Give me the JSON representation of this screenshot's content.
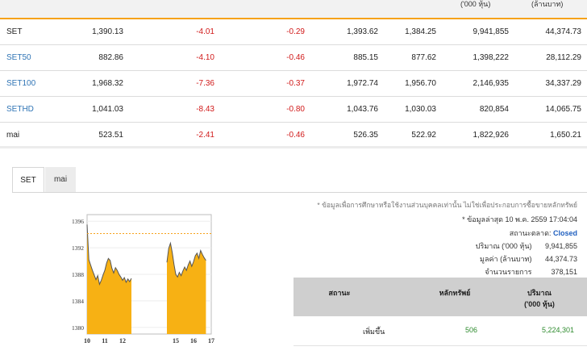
{
  "header": {
    "vol_unit": "('000 หุ้น)",
    "val_unit": "(ล้านบาท)"
  },
  "indices": [
    {
      "name": "SET",
      "last": "1,390.13",
      "change": "-4.01",
      "pct": "-0.29",
      "high": "1,393.62",
      "low": "1,384.25",
      "volume": "9,941,855",
      "value": "44,374.73"
    },
    {
      "name": "SET50",
      "last": "882.86",
      "change": "-4.10",
      "pct": "-0.46",
      "high": "885.15",
      "low": "877.62",
      "volume": "1,398,222",
      "value": "28,112.29"
    },
    {
      "name": "SET100",
      "last": "1,968.32",
      "change": "-7.36",
      "pct": "-0.37",
      "high": "1,972.74",
      "low": "1,956.70",
      "volume": "2,146,935",
      "value": "34,337.29"
    },
    {
      "name": "SETHD",
      "last": "1,041.03",
      "change": "-8.43",
      "pct": "-0.80",
      "high": "1,043.76",
      "low": "1,030.03",
      "volume": "820,854",
      "value": "14,065.75"
    },
    {
      "name": "mai",
      "last": "523.51",
      "change": "-2.41",
      "pct": "-0.46",
      "high": "526.35",
      "low": "522.92",
      "volume": "1,822,926",
      "value": "1,650.21"
    }
  ],
  "tabs": [
    "SET",
    "mai"
  ],
  "info": {
    "disclaimer": "* ข้อมูลเพื่อการศึกษาหรือใช้งานส่วนบุคคลเท่านั้น ไม่ใช่เพื่อประกอบการซื้อขายหลักทรัพย์",
    "updated": "* ข้อมูลล่าสุด 10 พ.ค. 2559 17:04:04",
    "market_status_label": "สถานะตลาด:",
    "market_status": "Closed",
    "volume_label": "ปริมาณ ('000 หุ้น)",
    "volume": "9,941,855",
    "value_label": "มูลค่า (ล้านบาท)",
    "value": "44,374.73",
    "trades_label": "จำนวนรายการ",
    "trades": "378,151"
  },
  "stat_table": {
    "col_status": "สถานะ",
    "col_securities": "หลักทรัพย์",
    "col_volume": "ปริมาณ\n('000 หุ้น)",
    "rows": [
      {
        "status": "เพิ่มขึ้น",
        "securities": "506",
        "volume": "5,224,301"
      }
    ]
  },
  "colors": {
    "accent": "#f6a21a",
    "negative": "#d11a1a",
    "positive": "#2e8b2e",
    "link": "#2f74b5"
  },
  "chart_data": {
    "type": "area",
    "title": "",
    "x_ticks": [
      "10",
      "11",
      "12",
      "15",
      "16",
      "17"
    ],
    "y_ticks": [
      1380,
      1384,
      1388,
      1392,
      1396
    ],
    "ylim": [
      1379,
      1397
    ],
    "reference_line": 1394.14,
    "sessions": [
      {
        "x": [
          10.0,
          10.1,
          10.2,
          10.3,
          10.4,
          10.5,
          10.6,
          10.7,
          10.8,
          10.9,
          11.0,
          11.1,
          11.2,
          11.3,
          11.4,
          11.5,
          11.6,
          11.7,
          11.8,
          11.9,
          12.0,
          12.1,
          12.2,
          12.3,
          12.4,
          12.5
        ],
        "y": [
          1395.5,
          1390.2,
          1389.4,
          1388.6,
          1387.9,
          1387.2,
          1387.8,
          1386.5,
          1387.1,
          1387.9,
          1388.6,
          1389.7,
          1390.4,
          1390.1,
          1388.9,
          1388.2,
          1389.0,
          1388.6,
          1388.0,
          1387.6,
          1387.1,
          1387.5,
          1386.8,
          1387.3,
          1386.9,
          1387.4
        ]
      },
      {
        "x": [
          14.5,
          14.6,
          14.7,
          14.8,
          14.9,
          15.0,
          15.1,
          15.2,
          15.3,
          15.4,
          15.5,
          15.6,
          15.7,
          15.8,
          15.9,
          16.0,
          16.1,
          16.2,
          16.3,
          16.4,
          16.5,
          16.6,
          16.7
        ],
        "y": [
          1389.8,
          1391.9,
          1392.7,
          1391.3,
          1389.5,
          1388.0,
          1387.6,
          1388.3,
          1387.8,
          1388.5,
          1389.1,
          1388.6,
          1389.4,
          1390.0,
          1389.2,
          1389.9,
          1390.8,
          1391.2,
          1390.4,
          1391.6,
          1391.0,
          1390.5,
          1390.1
        ]
      }
    ]
  }
}
